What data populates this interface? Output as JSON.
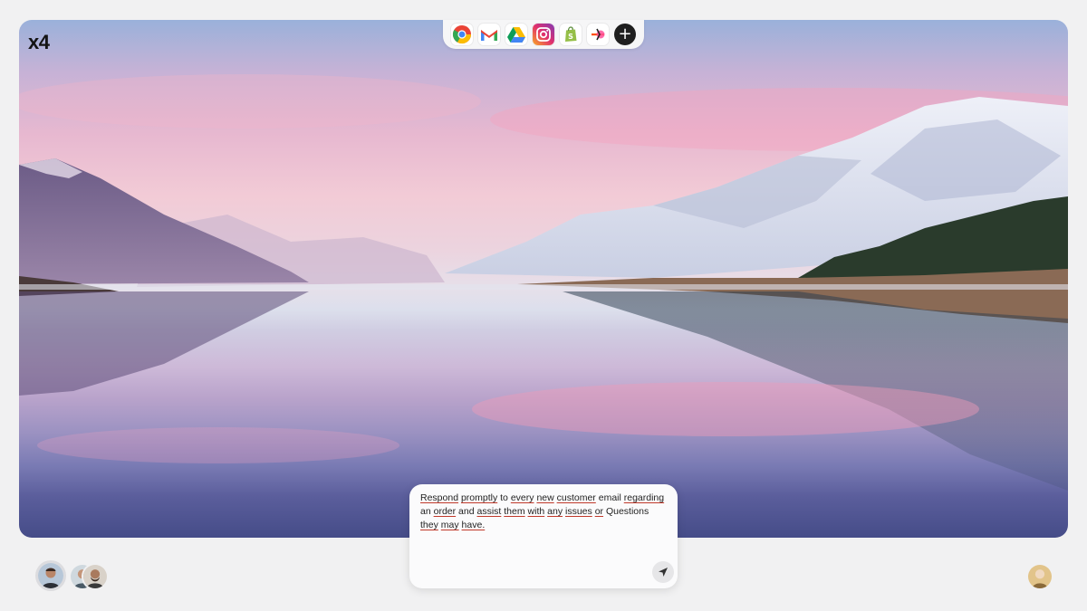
{
  "app": {
    "logo": "x4"
  },
  "dock": {
    "apps": [
      {
        "name": "Chrome",
        "icon": "chrome-icon"
      },
      {
        "name": "Gmail",
        "icon": "gmail-icon"
      },
      {
        "name": "Google Drive",
        "icon": "google-drive-icon"
      },
      {
        "name": "Instagram",
        "icon": "instagram-icon"
      },
      {
        "name": "Shopify",
        "icon": "shopify-icon"
      },
      {
        "name": "Zapier",
        "icon": "zapier-icon"
      }
    ],
    "add_icon": "plus-icon",
    "add_glyph": "+"
  },
  "prompt": {
    "words": [
      "Respond",
      "promptly",
      "to",
      "every",
      "new",
      "customer",
      "email",
      "regarding",
      "an",
      "order",
      "and",
      "assist",
      "them",
      "with",
      "any",
      "issues",
      "or",
      "Questions",
      "they",
      "may",
      "have."
    ],
    "underlined": [
      "Respond",
      "promptly",
      "every",
      "new",
      "customer",
      "regarding",
      "order",
      "assist",
      "them",
      "with",
      "any",
      "issues",
      "or",
      "they",
      "may",
      "have."
    ],
    "send_icon": "send-icon"
  },
  "avatars": {
    "left": [
      "user-avatar-active",
      "user-avatar-group"
    ],
    "right": "profile-avatar"
  }
}
